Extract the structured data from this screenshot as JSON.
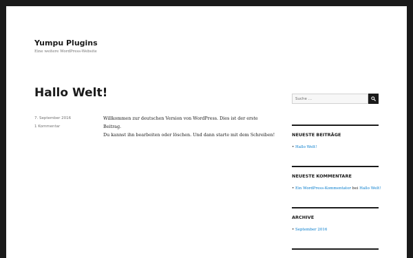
{
  "site": {
    "title": "Yumpu Plugins",
    "description": "Eine weitere WordPress-Website"
  },
  "post": {
    "title": "Hallo Welt!",
    "date": "7. September 2016",
    "comments_link": "1 Kommentar",
    "content_line1": "Willkommen zur deutschen Version von WordPress. Dies ist der erste Beitrag.",
    "content_line2": "Du kannst ihn bearbeiten oder löschen. Und dann starte mit dem Schreiben!"
  },
  "search": {
    "placeholder": "Suche …",
    "icon": "search-icon"
  },
  "widgets": {
    "recent_posts": {
      "title": "NEUESTE BEITRÄGE",
      "items": [
        "Hallo Welt!"
      ]
    },
    "recent_comments": {
      "title": "NEUESTE KOMMENTARE",
      "author": "Ein WordPress-Kommentator",
      "connector": "bei",
      "post": "Hallo Welt!"
    },
    "archive": {
      "title": "ARCHIVE",
      "items": [
        "September 2016"
      ]
    }
  },
  "colors": {
    "link": "#007acc",
    "text": "#1a1a1a",
    "meta": "#707070",
    "frame": "#1a1a1a"
  }
}
